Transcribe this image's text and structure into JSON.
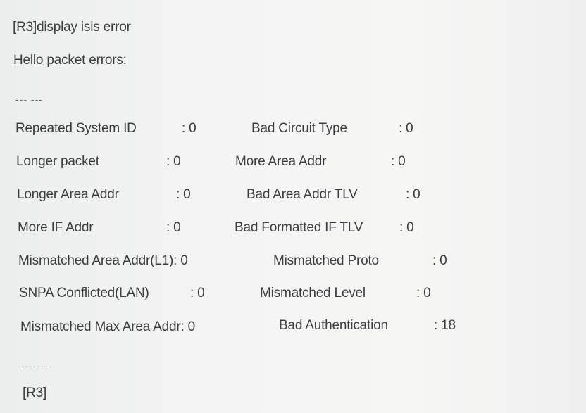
{
  "command": "[R3]display isis error",
  "section_header": "Hello packet errors:",
  "separator_top": "--- ---",
  "errors": [
    {
      "left_label": "Repeated System ID",
      "left_value": ": 0",
      "right_label": "Bad Circuit Type",
      "right_value": ": 0"
    },
    {
      "left_label": "Longer packet",
      "left_value": ": 0",
      "right_label": "More Area Addr",
      "right_value": ": 0"
    },
    {
      "left_label": "Longer Area Addr",
      "left_value": ": 0",
      "right_label": "Bad Area Addr TLV",
      "right_value": ": 0"
    },
    {
      "left_label": "More IF Addr",
      "left_value": ": 0",
      "right_label": "Bad Formatted IF TLV",
      "right_value": ": 0"
    },
    {
      "left_label": "Mismatched Area Addr(L1): 0",
      "left_value": "",
      "right_label": "Mismatched Proto",
      "right_value": ": 0"
    },
    {
      "left_label": "SNPA Conflicted(LAN)",
      "left_value": ": 0",
      "right_label": "Mismatched Level",
      "right_value": ": 0"
    },
    {
      "left_label": "Mismatched Max Area Addr: 0",
      "left_value": "",
      "right_label": "Bad Authentication",
      "right_value": ": 18"
    }
  ],
  "separator_bottom": "--- ---",
  "final_prompt": "[R3]"
}
